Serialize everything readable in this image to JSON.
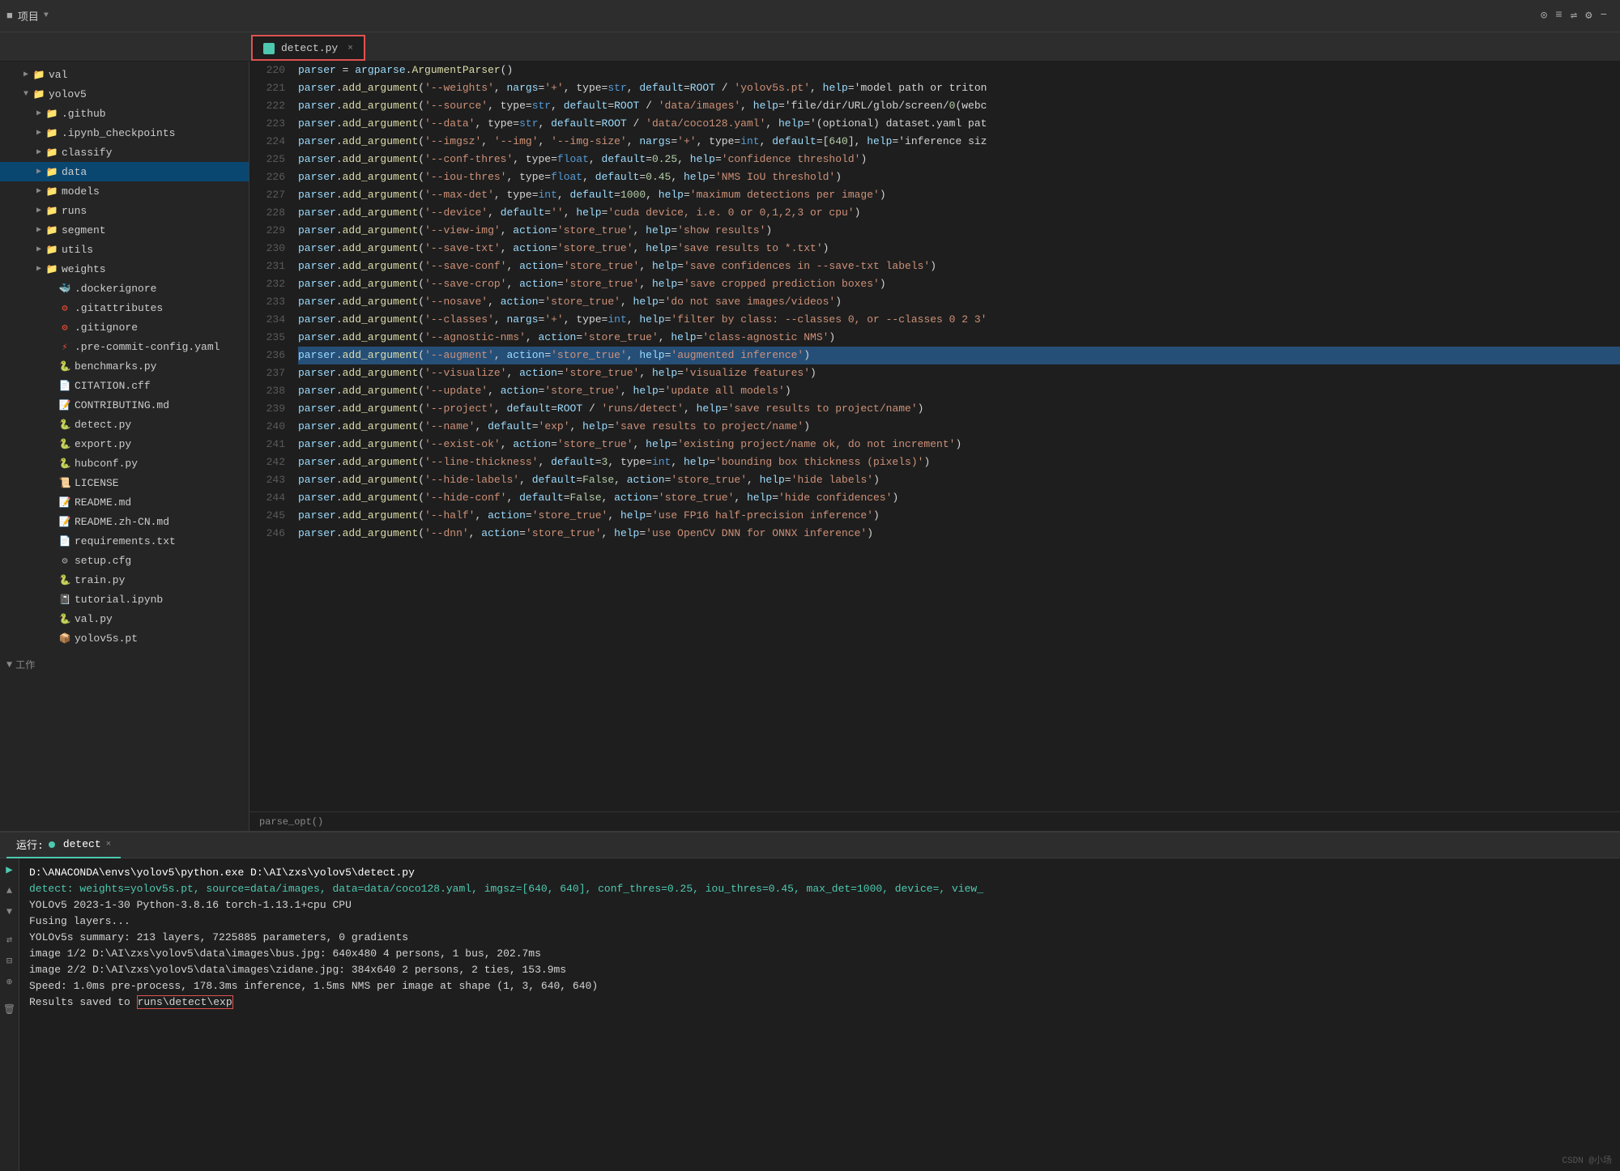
{
  "topBar": {
    "projectLabel": "项目",
    "icons": [
      "settings-circle",
      "list",
      "split",
      "gear",
      "minus"
    ]
  },
  "tab": {
    "name": "detect.py",
    "closeLabel": "×"
  },
  "sidebar": {
    "items": [
      {
        "id": "val",
        "label": "val",
        "type": "folder",
        "indent": 1,
        "expanded": false
      },
      {
        "id": "yolov5",
        "label": "yolov5",
        "type": "folder",
        "indent": 1,
        "expanded": true
      },
      {
        "id": "github",
        "label": ".github",
        "type": "folder",
        "indent": 2,
        "expanded": false
      },
      {
        "id": "ipynb_checkpoints",
        "label": ".ipynb_checkpoints",
        "type": "folder",
        "indent": 2,
        "expanded": false
      },
      {
        "id": "classify",
        "label": "classify",
        "type": "folder",
        "indent": 2,
        "expanded": false
      },
      {
        "id": "data",
        "label": "data",
        "type": "folder",
        "indent": 2,
        "expanded": false,
        "selected": true
      },
      {
        "id": "models",
        "label": "models",
        "type": "folder",
        "indent": 2,
        "expanded": false
      },
      {
        "id": "runs",
        "label": "runs",
        "type": "folder",
        "indent": 2,
        "expanded": false
      },
      {
        "id": "segment",
        "label": "segment",
        "type": "folder",
        "indent": 2,
        "expanded": false
      },
      {
        "id": "utils",
        "label": "utils",
        "type": "folder",
        "indent": 2,
        "expanded": false
      },
      {
        "id": "weights",
        "label": "weights",
        "type": "folder",
        "indent": 2,
        "expanded": false
      },
      {
        "id": "dockerignore",
        "label": ".dockerignore",
        "type": "file",
        "indent": 2,
        "fileType": "plain"
      },
      {
        "id": "gitattributes",
        "label": ".gitattributes",
        "type": "file",
        "indent": 2,
        "fileType": "git"
      },
      {
        "id": "gitignore",
        "label": ".gitignore",
        "type": "file",
        "indent": 2,
        "fileType": "git"
      },
      {
        "id": "precommit",
        "label": ".pre-commit-config.yaml",
        "type": "file",
        "indent": 2,
        "fileType": "yaml"
      },
      {
        "id": "benchmarks",
        "label": "benchmarks.py",
        "type": "file",
        "indent": 2,
        "fileType": "py"
      },
      {
        "id": "citation",
        "label": "CITATION.cff",
        "type": "file",
        "indent": 2,
        "fileType": "cff"
      },
      {
        "id": "contributing",
        "label": "CONTRIBUTING.md",
        "type": "file",
        "indent": 2,
        "fileType": "md"
      },
      {
        "id": "detect",
        "label": "detect.py",
        "type": "file",
        "indent": 2,
        "fileType": "py"
      },
      {
        "id": "export",
        "label": "export.py",
        "type": "file",
        "indent": 2,
        "fileType": "py"
      },
      {
        "id": "hubconf",
        "label": "hubconf.py",
        "type": "file",
        "indent": 2,
        "fileType": "py"
      },
      {
        "id": "license",
        "label": "LICENSE",
        "type": "file",
        "indent": 2,
        "fileType": "plain"
      },
      {
        "id": "readme",
        "label": "README.md",
        "type": "file",
        "indent": 2,
        "fileType": "md"
      },
      {
        "id": "readmecn",
        "label": "README.zh-CN.md",
        "type": "file",
        "indent": 2,
        "fileType": "md"
      },
      {
        "id": "requirements",
        "label": "requirements.txt",
        "type": "file",
        "indent": 2,
        "fileType": "txt"
      },
      {
        "id": "setup",
        "label": "setup.cfg",
        "type": "file",
        "indent": 2,
        "fileType": "cfg"
      },
      {
        "id": "train",
        "label": "train.py",
        "type": "file",
        "indent": 2,
        "fileType": "py"
      },
      {
        "id": "tutorial",
        "label": "tutorial.ipynb",
        "type": "file",
        "indent": 2,
        "fileType": "ipynb"
      },
      {
        "id": "val_py",
        "label": "val.py",
        "type": "file",
        "indent": 2,
        "fileType": "py"
      },
      {
        "id": "yolov5s",
        "label": "yolov5s.pt",
        "type": "file",
        "indent": 2,
        "fileType": "pt"
      }
    ],
    "workSection": "工作"
  },
  "codeLines": [
    {
      "num": 220,
      "content": "    parser = argparse.ArgumentParser()"
    },
    {
      "num": 221,
      "content": "    parser.add_argument('--weights', nargs='+', type=str, default=ROOT / 'yolov5s.pt', help='model path or triton"
    },
    {
      "num": 222,
      "content": "    parser.add_argument('--source', type=str, default=ROOT / 'data/images', help='file/dir/URL/glob/screen/0(webc"
    },
    {
      "num": 223,
      "content": "    parser.add_argument('--data', type=str, default=ROOT / 'data/coco128.yaml', help='(optional) dataset.yaml pat"
    },
    {
      "num": 224,
      "content": "    parser.add_argument('--imgsz', '--img', '--img-size', nargs='+', type=int, default=[640], help='inference siz"
    },
    {
      "num": 225,
      "content": "    parser.add_argument('--conf-thres', type=float, default=0.25, help='confidence threshold')"
    },
    {
      "num": 226,
      "content": "    parser.add_argument('--iou-thres', type=float, default=0.45, help='NMS IoU threshold')"
    },
    {
      "num": 227,
      "content": "    parser.add_argument('--max-det', type=int, default=1000, help='maximum detections per image')"
    },
    {
      "num": 228,
      "content": "    parser.add_argument('--device', default='', help='cuda device, i.e. 0 or 0,1,2,3 or cpu')"
    },
    {
      "num": 229,
      "content": "    parser.add_argument('--view-img', action='store_true', help='show results')"
    },
    {
      "num": 230,
      "content": "    parser.add_argument('--save-txt', action='store_true', help='save results to *.txt')"
    },
    {
      "num": 231,
      "content": "    parser.add_argument('--save-conf', action='store_true', help='save confidences in --save-txt labels')"
    },
    {
      "num": 232,
      "content": "    parser.add_argument('--save-crop', action='store_true', help='save cropped prediction boxes')"
    },
    {
      "num": 233,
      "content": "    parser.add_argument('--nosave', action='store_true', help='do not save images/videos')"
    },
    {
      "num": 234,
      "content": "    parser.add_argument('--classes', nargs='+', type=int, help='filter by class: --classes 0, or --classes 0 2 3'"
    },
    {
      "num": 235,
      "content": "    parser.add_argument('--agnostic-nms', action='store_true', help='class-agnostic NMS')"
    },
    {
      "num": 236,
      "content": "    parser.add_argument('--augment', action='store_true', help='augmented inference')",
      "highlighted": true
    },
    {
      "num": 237,
      "content": "    parser.add_argument('--visualize', action='store_true', help='visualize features')"
    },
    {
      "num": 238,
      "content": "    parser.add_argument('--update', action='store_true', help='update all models')"
    },
    {
      "num": 239,
      "content": "    parser.add_argument('--project', default=ROOT / 'runs/detect', help='save results to project/name')"
    },
    {
      "num": 240,
      "content": "    parser.add_argument('--name', default='exp', help='save results to project/name')"
    },
    {
      "num": 241,
      "content": "    parser.add_argument('--exist-ok', action='store_true', help='existing project/name ok, do not increment')"
    },
    {
      "num": 242,
      "content": "    parser.add_argument('--line-thickness', default=3, type=int, help='bounding box thickness (pixels)')"
    },
    {
      "num": 243,
      "content": "    parser.add_argument('--hide-labels', default=False, action='store_true', help='hide labels')"
    },
    {
      "num": 244,
      "content": "    parser.add_argument('--hide-conf', default=False, action='store_true', help='hide confidences')"
    },
    {
      "num": 245,
      "content": "    parser.add_argument('--half', action='store_true', help='use FP16 half-precision inference')"
    },
    {
      "num": 246,
      "content": "    parser.add_argument('--dnn', action='store_true', help='use OpenCV DNN for ONNX inference')"
    }
  ],
  "breadcrumb": "parse_opt()",
  "terminal": {
    "tabLabel": "运行:",
    "runLabel": "detect",
    "closeLabel": "×",
    "lines": [
      {
        "text": "D:\\ANACONDA\\envs\\yolov5\\python.exe D:\\AI\\zxs\\yolov5\\detect.py",
        "color": "white"
      },
      {
        "text": "detect: weights=yolov5s.pt, source=data/images, data=data/coco128.yaml, imgsz=[640, 640], conf_thres=0.25, iou_thres=0.45, max_det=1000, device=, view_",
        "color": "green"
      },
      {
        "text": "YOLOv5  2023-1-30 Python-3.8.16 torch-1.13.1+cpu CPU",
        "color": "plain"
      },
      {
        "text": "",
        "color": "plain"
      },
      {
        "text": "Fusing layers...",
        "color": "plain"
      },
      {
        "text": "YOLOv5s summary: 213 layers, 7225885 parameters, 0 gradients",
        "color": "plain"
      },
      {
        "text": "image 1/2 D:\\AI\\zxs\\yolov5\\data\\images\\bus.jpg: 640x480 4 persons, 1 bus, 202.7ms",
        "color": "plain"
      },
      {
        "text": "image 2/2 D:\\AI\\zxs\\yolov5\\data\\images\\zidane.jpg: 384x640 2 persons, 2 ties, 153.9ms",
        "color": "plain"
      },
      {
        "text": "Speed: 1.0ms pre-process, 178.3ms inference, 1.5ms NMS per image at shape (1, 3, 640, 640)",
        "color": "plain"
      },
      {
        "text": "Results saved to runs\\detect\\exp",
        "color": "plain",
        "highlight": "runs\\detect\\exp"
      }
    ]
  },
  "watermark": "CSDN @小场"
}
